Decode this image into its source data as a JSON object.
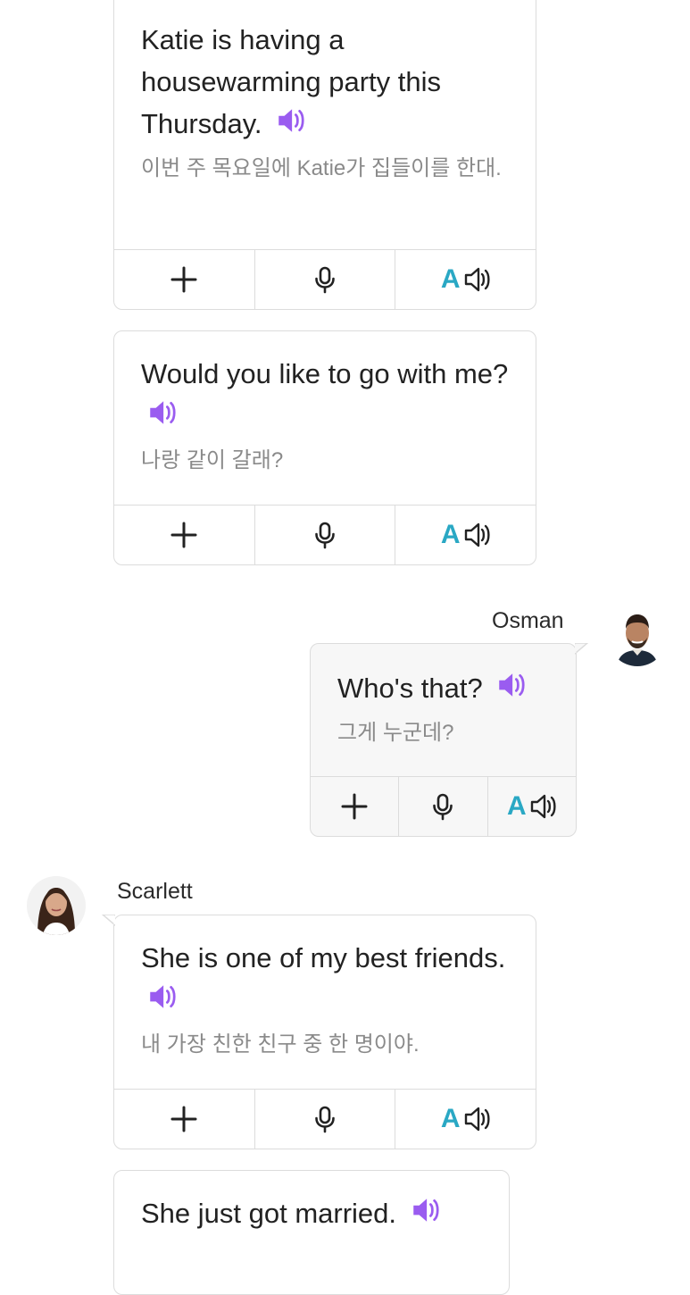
{
  "messages": [
    {
      "en": "Katie is having a housewarming party this Thursday.",
      "ko": "이번 주 목요일에 Katie가 집들이를 한대."
    },
    {
      "en": "Would you like to go with me?",
      "ko": "나랑 같이 갈래?"
    },
    {
      "speaker": "Osman",
      "en": "Who's that?",
      "ko": "그게 누군데?"
    },
    {
      "speaker": "Scarlett",
      "en": "She is one of my best friends.",
      "ko": "내 가장 친한 친구 중 한 명이야."
    },
    {
      "en": "She just got married."
    }
  ],
  "actions": {
    "add": "+",
    "mic": "mic",
    "font_letter": "A"
  },
  "colors": {
    "speaker_icon": "#9a5cf0",
    "font_letter": "#2aa8c4",
    "border": "#dcdcdc"
  },
  "icons": [
    "speaker-icon",
    "plus-icon",
    "mic-icon",
    "text-to-speech-icon"
  ]
}
